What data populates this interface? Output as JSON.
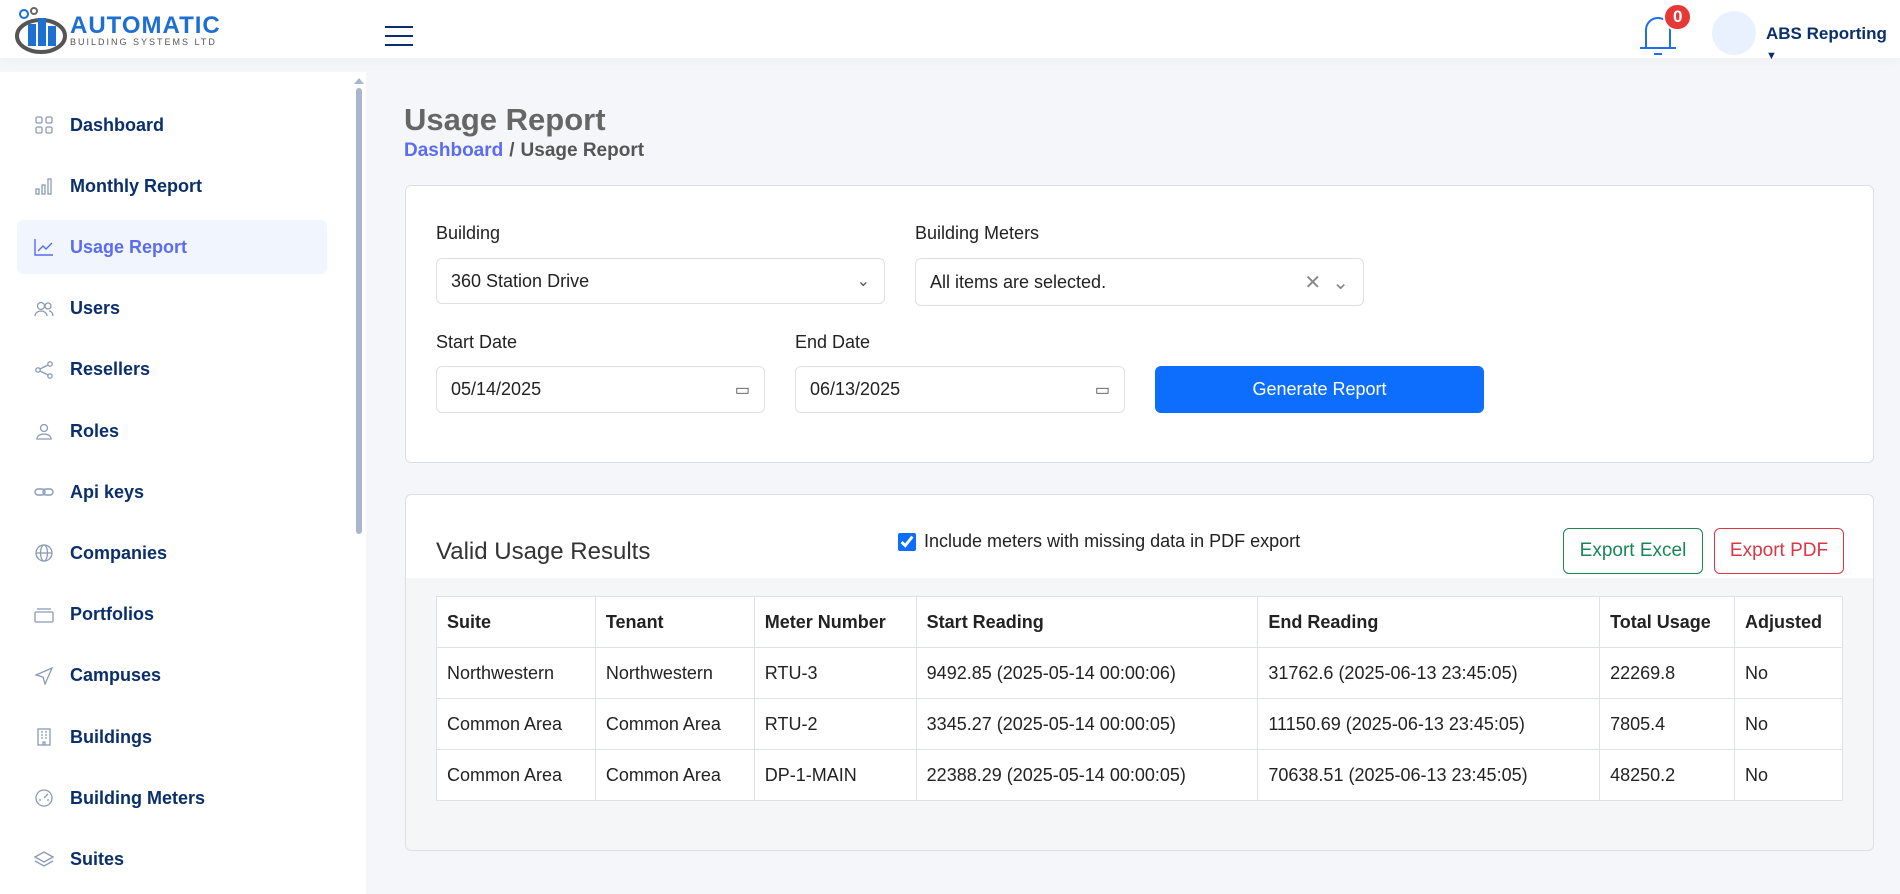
{
  "header": {
    "logo_text": "AUTOMATIC",
    "logo_subtext": "BUILDING SYSTEMS LTD",
    "notification_count": "0",
    "user_name": "ABS Reporting"
  },
  "sidebar": {
    "items": [
      {
        "label": "Dashboard",
        "icon": "grid-icon"
      },
      {
        "label": "Monthly Report",
        "icon": "bar-chart-icon"
      },
      {
        "label": "Usage Report",
        "icon": "line-chart-icon",
        "active": true
      },
      {
        "label": "Users",
        "icon": "users-icon"
      },
      {
        "label": "Resellers",
        "icon": "share-icon"
      },
      {
        "label": "Roles",
        "icon": "user-icon"
      },
      {
        "label": "Api keys",
        "icon": "link-icon"
      },
      {
        "label": "Companies",
        "icon": "globe-icon"
      },
      {
        "label": "Portfolios",
        "icon": "briefcase-icon"
      },
      {
        "label": "Campuses",
        "icon": "send-icon"
      },
      {
        "label": "Buildings",
        "icon": "building-icon"
      },
      {
        "label": "Building Meters",
        "icon": "gauge-icon"
      },
      {
        "label": "Suites",
        "icon": "layers-icon"
      }
    ]
  },
  "page": {
    "title": "Usage Report",
    "breadcrumb": {
      "home": "Dashboard",
      "current": "Usage Report"
    }
  },
  "filters": {
    "building_label": "Building",
    "building_value": "360 Station Drive",
    "meters_label": "Building Meters",
    "meters_value": "All items are selected.",
    "start_label": "Start Date",
    "start_value": "05/14/2025",
    "end_label": "End Date",
    "end_value": "06/13/2025",
    "generate_label": "Generate Report"
  },
  "results": {
    "title": "Valid Usage Results",
    "include_missing_label": "Include meters with missing data in PDF export",
    "include_missing_checked": true,
    "export_excel": "Export Excel",
    "export_pdf": "Export PDF",
    "columns": [
      "Suite",
      "Tenant",
      "Meter Number",
      "Start Reading",
      "End Reading",
      "Total Usage",
      "Adjusted"
    ],
    "rows": [
      [
        "Northwestern",
        "Northwestern",
        "RTU-3",
        "9492.85 (2025-05-14 00:00:06)",
        "31762.6 (2025-06-13 23:45:05)",
        "22269.8",
        "No"
      ],
      [
        "Common Area",
        "Common Area",
        "RTU-2",
        "3345.27 (2025-05-14 00:00:05)",
        "11150.69 (2025-06-13 23:45:05)",
        "7805.4",
        "No"
      ],
      [
        "Common Area",
        "Common Area",
        "DP-1-MAIN",
        "22388.29 (2025-05-14 00:00:05)",
        "70638.51 (2025-06-13 23:45:05)",
        "48250.2",
        "No"
      ]
    ]
  },
  "colors": {
    "primary": "#0d6efd",
    "active_nav": "#5b6cf0",
    "nav_text": "#0a2f6b",
    "excel": "#198754",
    "pdf": "#dc3545",
    "badge": "#e53935"
  }
}
